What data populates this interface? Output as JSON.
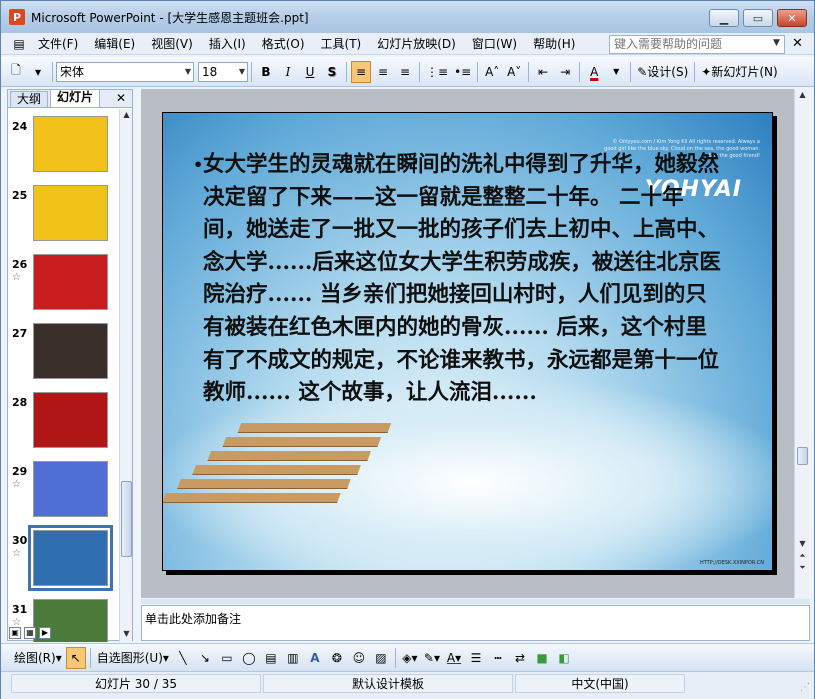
{
  "window": {
    "title": "Microsoft PowerPoint - [大学生感恩主题班会.ppt]",
    "app_icon_letter": "P"
  },
  "menu": {
    "items": [
      "文件(F)",
      "编辑(E)",
      "视图(V)",
      "插入(I)",
      "格式(O)",
      "工具(T)",
      "幻灯片放映(D)",
      "窗口(W)",
      "帮助(H)"
    ],
    "help_placeholder": "键入需要帮助的问题"
  },
  "toolbar": {
    "font_name": "宋体",
    "font_size": "18",
    "bold": "B",
    "italic": "I",
    "underline": "U",
    "shadow": "S",
    "design_label": "设计(S)",
    "new_slide_label": "新幻灯片(N)"
  },
  "pane": {
    "tab_outline": "大纲",
    "tab_slides": "幻灯片",
    "close": "✕"
  },
  "thumbnails": [
    {
      "num": "24",
      "star": false,
      "bg": "#f2c21a"
    },
    {
      "num": "25",
      "star": false,
      "bg": "#f1c319"
    },
    {
      "num": "26",
      "star": true,
      "bg": "#c81e1e"
    },
    {
      "num": "27",
      "star": false,
      "bg": "#3a2f2a"
    },
    {
      "num": "28",
      "star": false,
      "bg": "#b01616"
    },
    {
      "num": "29",
      "star": true,
      "bg": "#4f6fd6"
    },
    {
      "num": "30",
      "star": true,
      "bg": "#2f6fb0",
      "selected": true
    },
    {
      "num": "31",
      "star": true,
      "bg": "#4b7a3a"
    }
  ],
  "slide": {
    "text": "女大学生的灵魂就在瞬间的洗礼中得到了升华，她毅然决定留了下来——这一留就是整整二十年。 二十年间，她送走了一批又一批的孩子们去上初中、上高中、念大学......后来这位女大学生积劳成疾，被送往北京医院治疗...... 当乡亲们把她接回山村时，人们见到的只有被装在红色木匣内的她的骨灰...... 后来，这个村里有了不成文的规定，不论谁来教书，永远都是第十一位教师...... 这个故事，让人流泪......",
    "copyright": "© Onlyyou.com / Kim Yong Kil All rights reserved. Always a good girl like the blue sky. Cloud on the sea, the good woman. Say the good friend!",
    "logo": "YOHYAI",
    "url": "HTTP://DESK.XXINPOR.CN"
  },
  "notes": {
    "placeholder": "单击此处添加备注"
  },
  "drawbar": {
    "draw_label": "绘图(R)",
    "autoshapes_label": "自选图形(U)"
  },
  "status": {
    "slide_pos": "幻灯片 30 / 35",
    "template": "默认设计模板",
    "language": "中文(中国)"
  }
}
